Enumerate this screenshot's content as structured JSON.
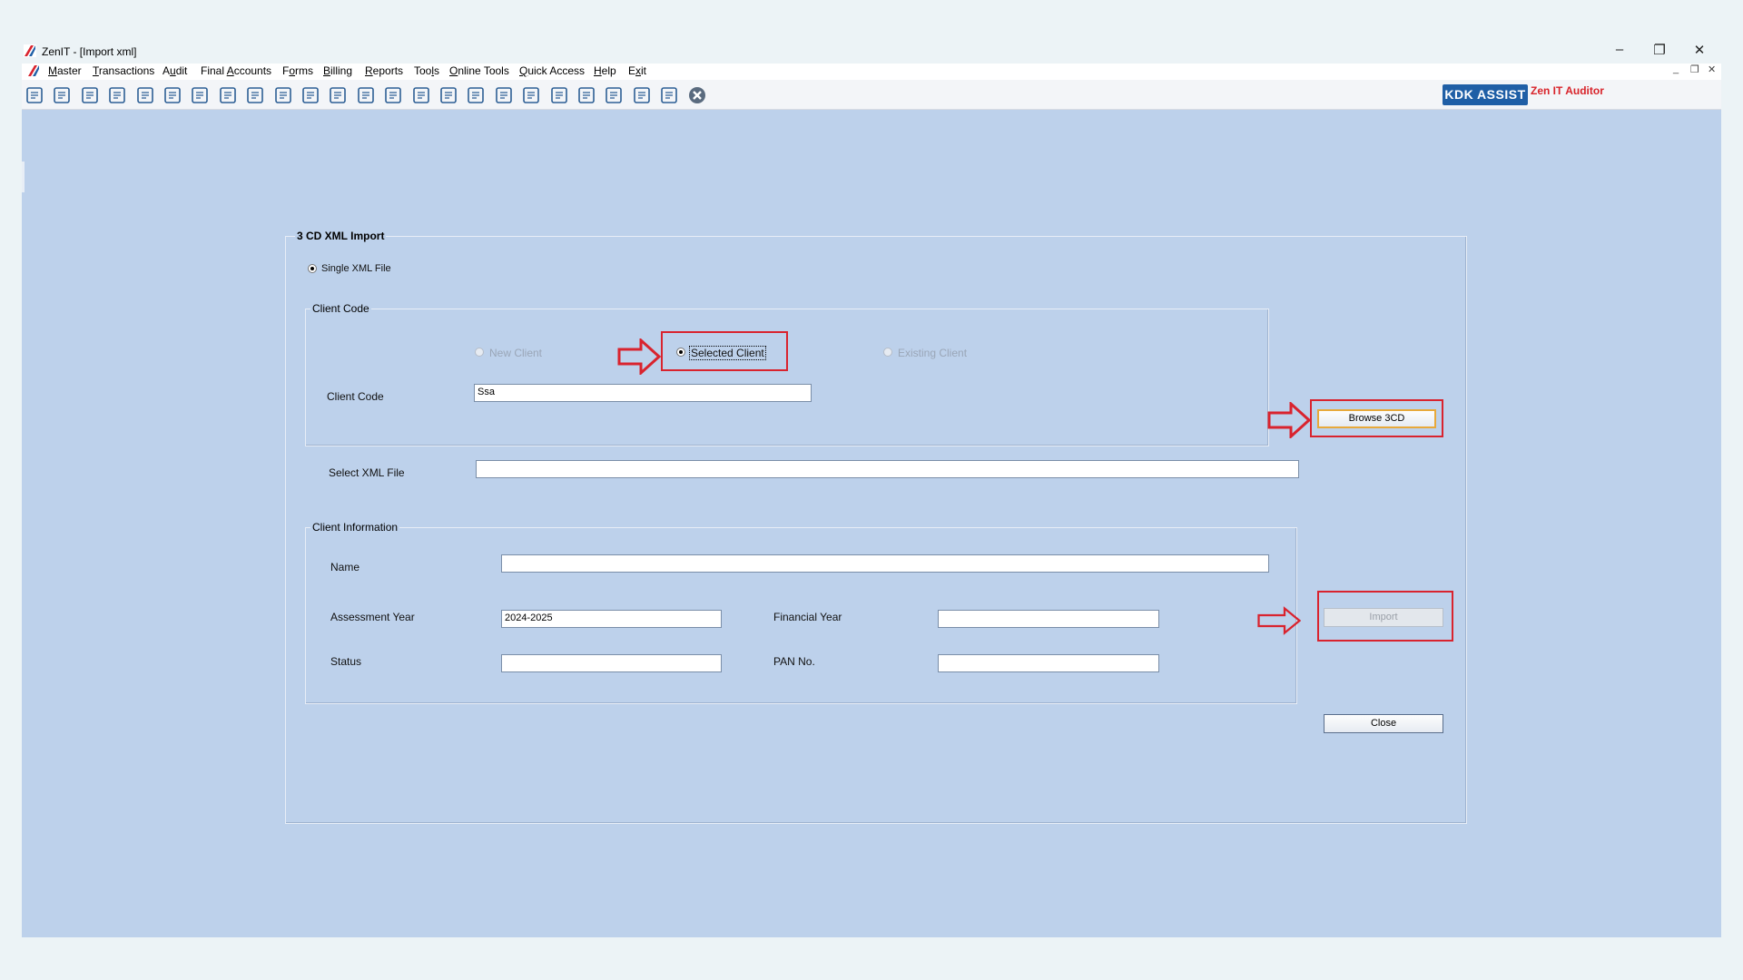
{
  "window": {
    "title": "ZenIT - [Import xml]",
    "controls": [
      "minimize",
      "restore",
      "close"
    ]
  },
  "menu": {
    "items": [
      {
        "label": "Master",
        "underline": "M"
      },
      {
        "label": "Transactions",
        "underline": "T"
      },
      {
        "label": "Audit",
        "underline": "u"
      },
      {
        "label": "Final Accounts",
        "underline": "A"
      },
      {
        "label": "Forms",
        "underline": "o"
      },
      {
        "label": "Billing",
        "underline": "B"
      },
      {
        "label": "Reports",
        "underline": "R"
      },
      {
        "label": "Tools",
        "underline": "l"
      },
      {
        "label": "Online Tools",
        "underline": "O"
      },
      {
        "label": "Quick Access",
        "underline": "Q"
      },
      {
        "label": "Help",
        "underline": "H"
      },
      {
        "label": "Exit",
        "underline": "x"
      }
    ]
  },
  "toolbar": {
    "icons": [
      "open-icon",
      "home-icon",
      "building-icon",
      "bar-chart-icon",
      "gift-icon",
      "users-icon",
      "pin-icon",
      "filter-icon",
      "tax-icon",
      "forward-icon",
      "calculator-icon",
      "pie-chart-icon",
      "pay-icon",
      "book-icon",
      "info-icon",
      "report-icon",
      "document-edit-icon",
      "calendar-icon",
      "refresh-icon",
      "export-icon",
      "card-icon",
      "bank-icon",
      "3cd-icon",
      "grid-icon",
      "close-circle-icon"
    ],
    "brand_badge": "KDK ASSIST",
    "brand_text": "Zen IT Auditor"
  },
  "form": {
    "group_title": "3 CD XML Import",
    "single_xml_label": "Single XML File",
    "client_code_group": "Client Code",
    "radio_new": "New Client",
    "radio_selected": "Selected Client",
    "radio_existing": "Existing Client",
    "client_code_label": "Client Code",
    "client_code_value": "Ssa",
    "select_xml_label": "Select XML File",
    "select_xml_value": "",
    "browse_button": "Browse 3CD",
    "client_info_group": "Client Information",
    "name_label": "Name",
    "name_value": "",
    "assessment_year_label": "Assessment Year",
    "assessment_year_value": "2024-2025",
    "financial_year_label": "Financial Year",
    "financial_year_value": "",
    "status_label": "Status",
    "status_value": "",
    "pan_label": "PAN No.",
    "pan_value": "",
    "import_button": "Import",
    "close_button": "Close"
  },
  "colors": {
    "workspace": "#bdd1eb",
    "highlight": "#d9232e",
    "brand": "#1f5fa6"
  }
}
